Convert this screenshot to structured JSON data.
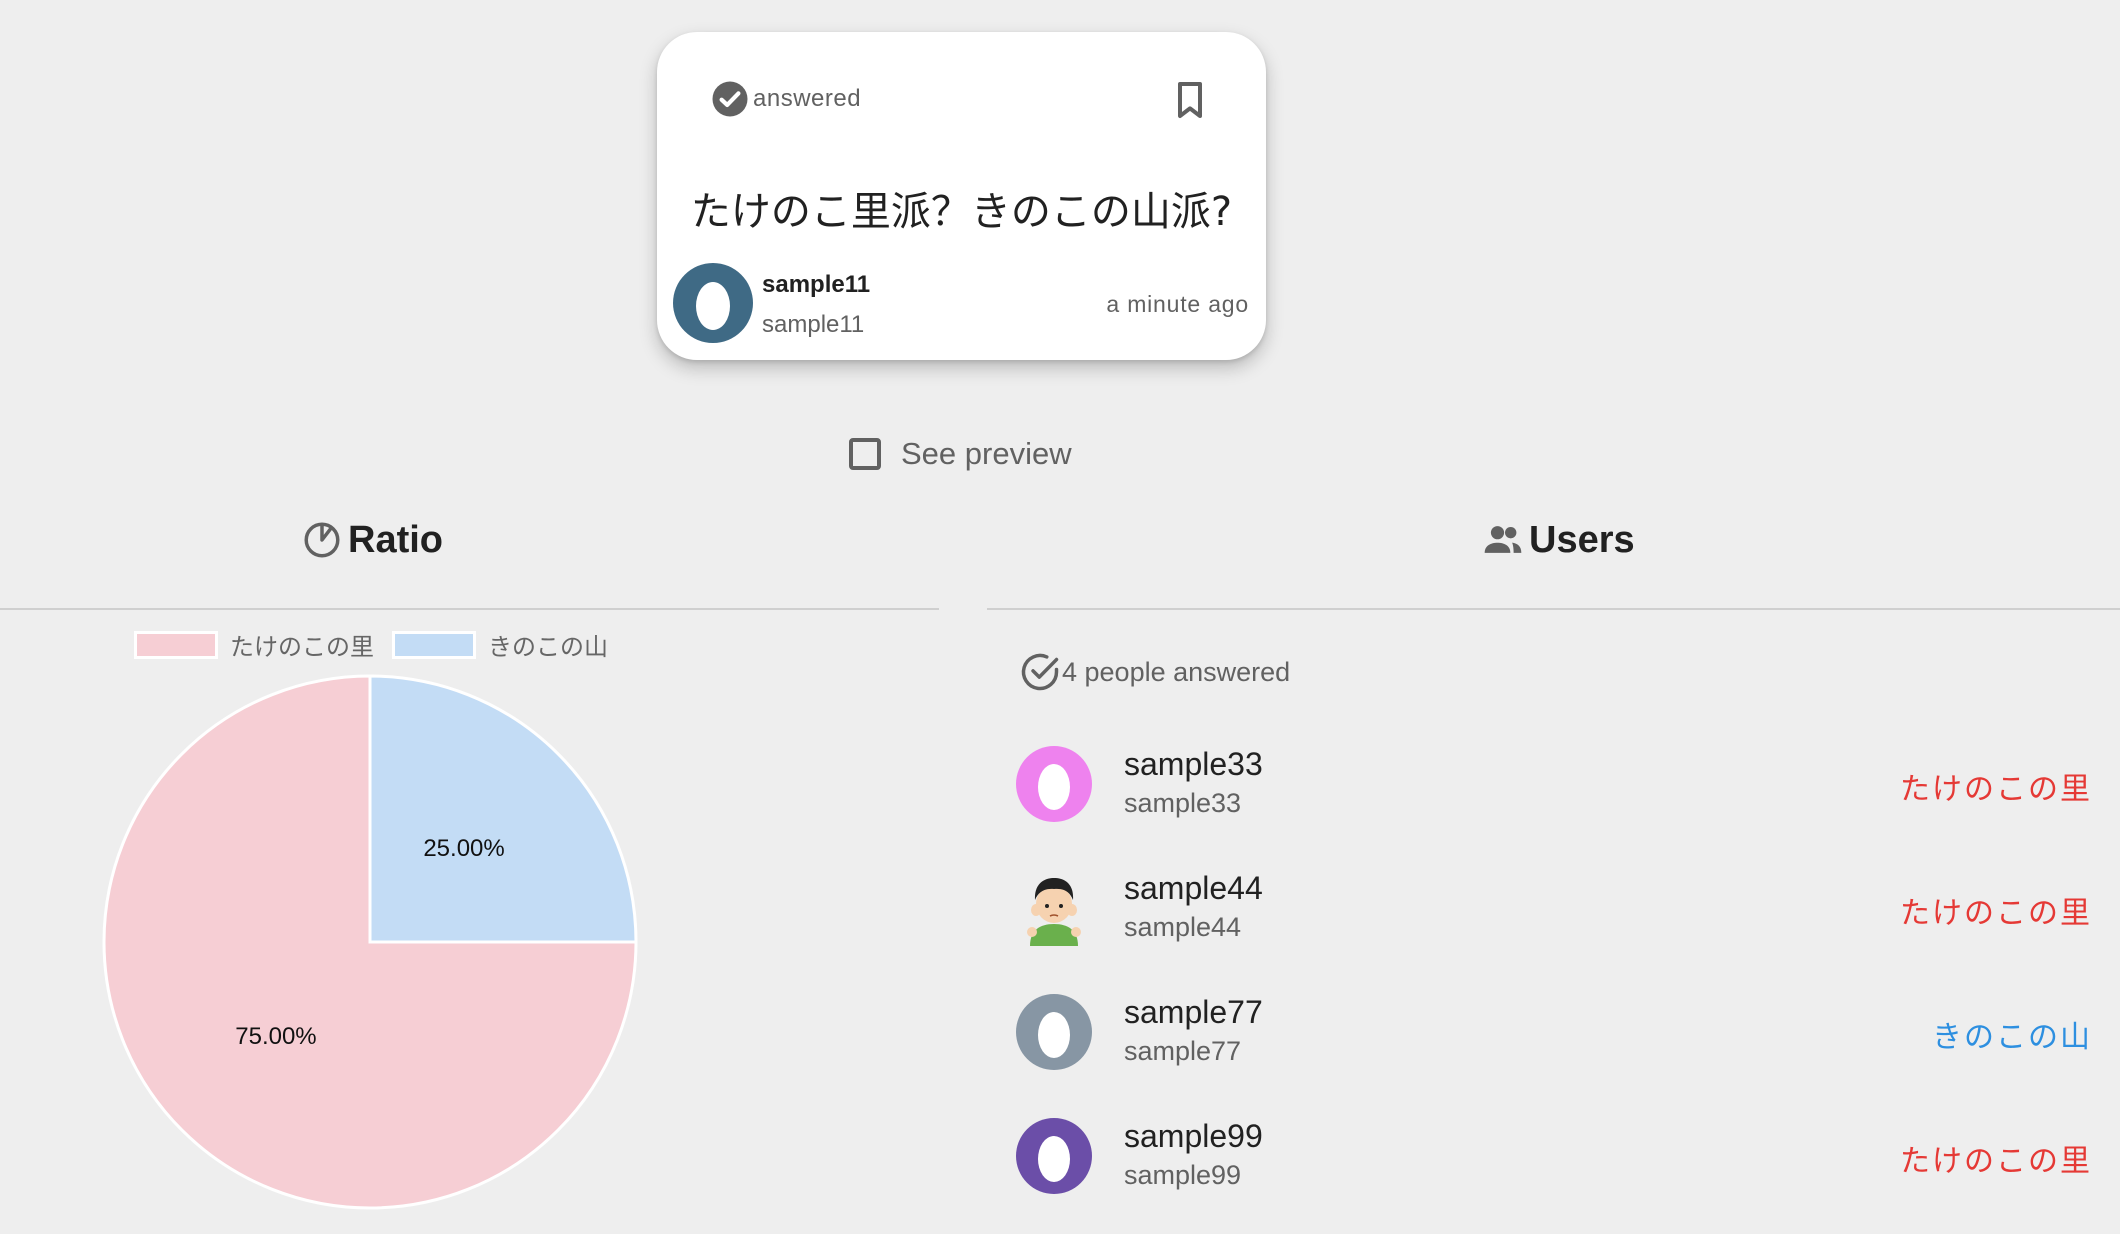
{
  "question_card": {
    "status_icon": "check-circle-icon",
    "status_label": "answered",
    "bookmark_icon": "bookmark-outline-icon",
    "question": "たけのこ里派？きのこの山派?",
    "author": {
      "name": "sample11",
      "id": "sample11",
      "time": "a minute ago",
      "avatar_icon": "egg-avatar-icon",
      "avatar_color": "#3f6a85"
    }
  },
  "preview": {
    "label": "See preview",
    "checked": false
  },
  "ratio_section": {
    "icon": "pie-chart-outline-icon",
    "title": "Ratio"
  },
  "users_section": {
    "icon": "people-icon",
    "title": "Users",
    "answered_icon": "check-circle-outline-icon",
    "answered_label": "4 people answered",
    "users": [
      {
        "name": "sample33",
        "id": "sample33",
        "choice": "たけのこの里",
        "avatar_icon": "egg-avatar-icon",
        "avatar_color": "#ee82ee"
      },
      {
        "name": "sample44",
        "id": "sample44",
        "choice": "たけのこの里",
        "avatar_icon": "boy-illustration-avatar-icon",
        "avatar_color": "#6ab04c"
      },
      {
        "name": "sample77",
        "id": "sample77",
        "choice": "きのこの山",
        "avatar_icon": "egg-avatar-icon",
        "avatar_color": "#8796a4"
      },
      {
        "name": "sample99",
        "id": "sample99",
        "choice": "たけのこの里",
        "avatar_icon": "egg-avatar-icon",
        "avatar_color": "#6b4ea8"
      }
    ]
  },
  "chart_data": {
    "type": "pie",
    "categories": [
      "たけのこの里",
      "きのこの山"
    ],
    "values": [
      75,
      25
    ],
    "labels": [
      "75.00%",
      "25.00%"
    ],
    "colors": [
      "#f6ced4",
      "#c3dcf5"
    ],
    "legend_position": "top"
  },
  "colors": {
    "take_choice": "#e53935",
    "kino_choice": "#2d8fe0",
    "background": "#eeeeee"
  }
}
